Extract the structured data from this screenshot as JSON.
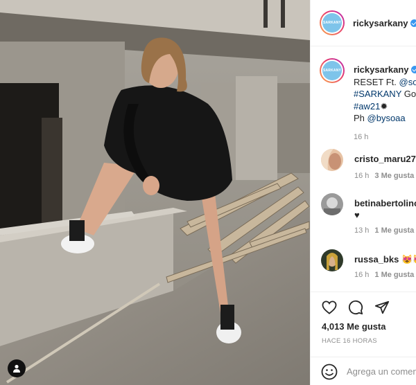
{
  "post": {
    "username": "rickysarkany",
    "avatar_text": "SARKANY",
    "caption": {
      "line1_text": "RESET Ft. ",
      "line1_mention": "@soff",
      "line2_hashtag": "#SARKANY",
      "line2_text": " Goo",
      "line3_hashtag": "#aw21",
      "line3_emoji": "✹",
      "line4_text": "Ph ",
      "line4_mention": "@bysoaa",
      "time": "16 h"
    },
    "comments": [
      {
        "user": "cristo_maru27",
        "text": "",
        "time": "16 h",
        "likes": "3 Me gusta"
      },
      {
        "user": "betinabertolino",
        "text": "♥",
        "time": "13 h",
        "likes": "1 Me gusta"
      },
      {
        "user": "russa_bks",
        "text": "😻😻😻",
        "time": "16 h",
        "likes": "1 Me gusta"
      }
    ],
    "likes_count": "4,013 Me gusta",
    "posted_ago": "HACE 16 HORAS",
    "add_comment_placeholder": "Agrega un comentario..."
  },
  "icons": [
    "user-tag-icon",
    "heart-icon",
    "comment-icon",
    "share-icon",
    "emoji-icon",
    "verified-icon"
  ],
  "colors": {
    "link": "#00376b",
    "verified": "#3897f0",
    "meta": "#8e8e8e",
    "brand_logo": "#7ec4ea"
  }
}
